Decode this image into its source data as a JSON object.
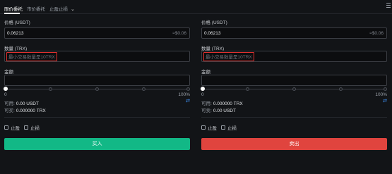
{
  "tabs": {
    "limit": "限价委托",
    "market": "市价委托",
    "stop": "止盈止损"
  },
  "buy": {
    "price_label": "价格 (USDT)",
    "price_value": "0.06213",
    "price_suffix": "≈$0.06",
    "qty_label": "数量 (TRX)",
    "qty_placeholder": "最小交易数量是10TRX",
    "amount_label": "金额",
    "slider_min": "0",
    "slider_max": "100%",
    "available_label": "可用:",
    "available_value": "0.00 USDT",
    "buyable_label": "可买:",
    "buyable_value": "0.000000 TRX",
    "take_profit": "止盈",
    "stop_loss": "止损",
    "button": "买入"
  },
  "sell": {
    "price_label": "价格 (USDT)",
    "price_value": "0.06213",
    "price_suffix": "≈$0.06",
    "qty_label": "数量 (TRX)",
    "qty_placeholder": "最小交易数量是10TRX",
    "amount_label": "金额",
    "slider_min": "0",
    "slider_max": "100%",
    "available_label": "可用:",
    "available_value": "0.000000 TRX",
    "sellable_label": "可卖:",
    "sellable_value": "0.00 USDT",
    "take_profit": "止盈",
    "stop_loss": "止损",
    "button": "卖出"
  },
  "colors": {
    "buy": "#12b886",
    "sell": "#e0443e",
    "highlight": "#e0302e",
    "accent": "#3d8ef0"
  },
  "icons": {
    "dropdown": "chevron-down-icon",
    "corner": "menu-icon",
    "swap": "swap-icon"
  }
}
